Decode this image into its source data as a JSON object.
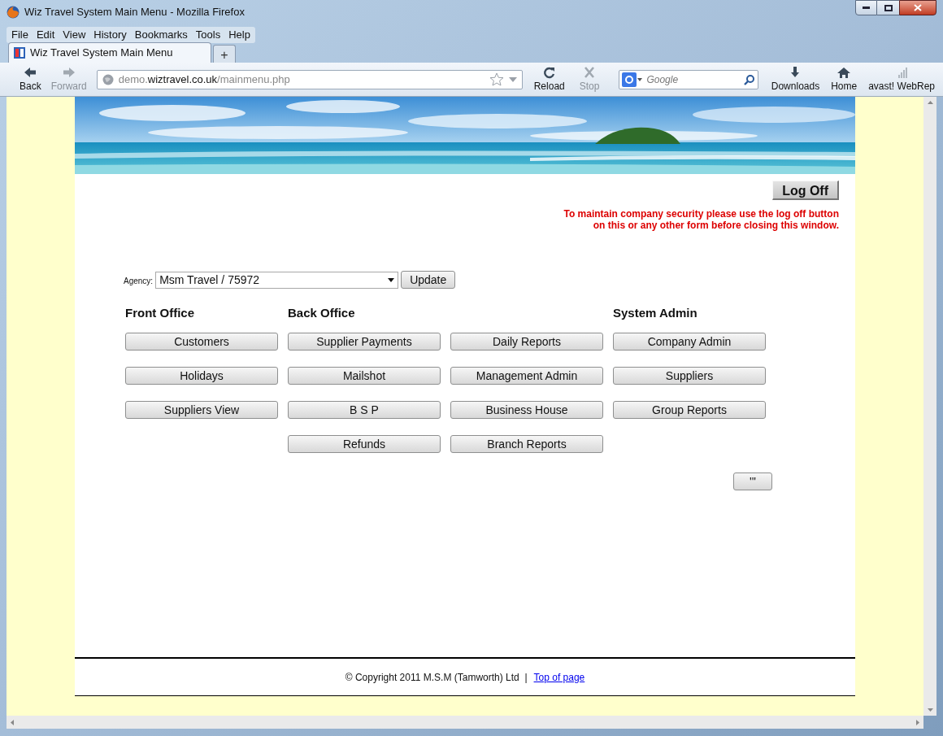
{
  "window": {
    "title": "Wiz Travel System Main Menu - Mozilla Firefox"
  },
  "menu_bar": [
    "File",
    "Edit",
    "View",
    "History",
    "Bookmarks",
    "Tools",
    "Help"
  ],
  "tabs": [
    {
      "label": "Wiz Travel System Main Menu",
      "selected": true
    }
  ],
  "new_tab": "+",
  "toolbar": {
    "nav": [
      {
        "kind": "back",
        "label": "Back",
        "disabled": false
      },
      {
        "kind": "forward",
        "label": "Forward",
        "disabled": true
      }
    ],
    "address": {
      "host_pre": "demo.",
      "host": "wiztravel.co.uk",
      "path": "/mainmenu.php"
    },
    "actions": [
      {
        "kind": "reload",
        "label": "Reload",
        "disabled": false
      },
      {
        "kind": "stop",
        "label": "Stop",
        "disabled": true
      }
    ],
    "search": {
      "placeholder": "Google"
    },
    "extras": [
      {
        "kind": "downloads",
        "label": "Downloads"
      },
      {
        "kind": "home",
        "label": "Home"
      },
      {
        "kind": "webrep",
        "label": "avast! WebRep"
      }
    ]
  },
  "page": {
    "log_off": "Log Off",
    "security_notice": [
      "To maintain company security please use the log off button",
      "on this or any other form before closing this window."
    ],
    "agency": {
      "label": "Agency:",
      "value": "Msm Travel / 75972",
      "button": "Update"
    },
    "columns": [
      {
        "heading": "Front Office",
        "buttons": [
          "Customers",
          "Holidays",
          "Suppliers View"
        ]
      },
      {
        "heading": "Back Office",
        "buttons": [
          "Supplier Payments",
          "Mailshot",
          "B S P",
          "Refunds"
        ]
      },
      {
        "buttons": [
          "Daily Reports",
          "Management Admin",
          "Business House",
          "Branch Reports"
        ]
      },
      {
        "heading": "System Admin",
        "buttons": [
          "Company Admin",
          "Suppliers",
          "Group Reports"
        ]
      }
    ],
    "extra_button": "'''",
    "footer": {
      "copyright": "© Copyright 2011 M.S.M (Tamworth) Ltd  |",
      "link": "Top of page"
    }
  }
}
